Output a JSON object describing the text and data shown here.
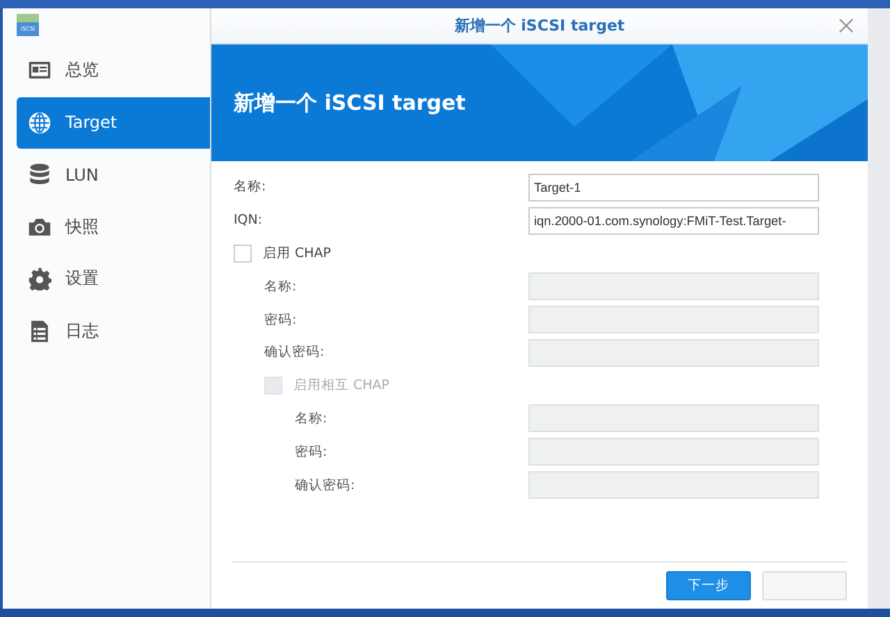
{
  "app_icon_label": "iSCSI",
  "sidebar": {
    "items": [
      {
        "label": "总览",
        "selected": false
      },
      {
        "label": "Target",
        "selected": true
      },
      {
        "label": "LUN",
        "selected": false
      },
      {
        "label": "快照",
        "selected": false
      },
      {
        "label": "设置",
        "selected": false
      },
      {
        "label": "日志",
        "selected": false
      }
    ]
  },
  "dialog": {
    "title": "新增一个 iSCSI target",
    "banner_title": "新增一个 iSCSI target",
    "form": [
      {
        "kind": "field",
        "label": "名称:",
        "value": "Target-1",
        "disabled": false
      },
      {
        "kind": "field",
        "label": "IQN:",
        "value": "iqn.2000-01.com.synology:FMiT-Test.Target-",
        "disabled": false
      },
      {
        "kind": "checkbox",
        "label": "启用 CHAP",
        "checked": false,
        "disabled": false,
        "children": [
          {
            "kind": "field",
            "label": "名称:",
            "disabled": true
          },
          {
            "kind": "field",
            "label": "密码:",
            "disabled": true
          },
          {
            "kind": "field",
            "label": "确认密码:",
            "disabled": true
          },
          {
            "kind": "checkbox",
            "label": "启用相互 CHAP",
            "checked": false,
            "disabled": true,
            "children": [
              {
                "kind": "field",
                "label": "名称:",
                "disabled": true
              },
              {
                "kind": "field",
                "label": "密码:",
                "disabled": true
              },
              {
                "kind": "field",
                "label": "确认密码:",
                "disabled": true
              }
            ]
          }
        ]
      }
    ],
    "buttons": [
      {
        "kind": "primary",
        "label": "下一步"
      },
      {
        "kind": "plain"
      }
    ]
  }
}
